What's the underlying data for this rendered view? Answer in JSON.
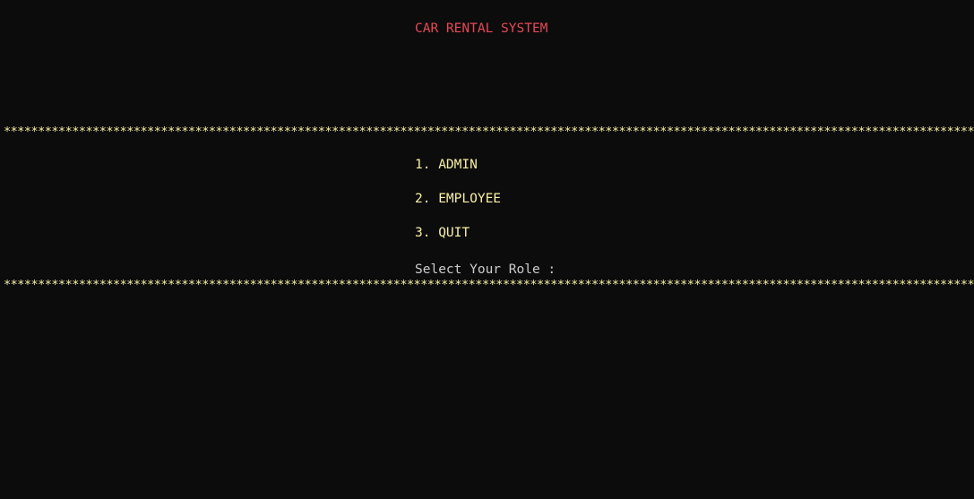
{
  "console": {
    "title": "CAR RENTAL SYSTEM",
    "separator": "*****************************************************************************************************************************************************************",
    "menu": [
      {
        "label": "1. ADMIN"
      },
      {
        "label": "2. EMPLOYEE"
      },
      {
        "label": "3. QUIT"
      }
    ],
    "prompt": "Select Your Role :"
  },
  "colors": {
    "background": "#0c0c0c",
    "title": "#e74856",
    "menu": "#f9f1a5",
    "separator": "#f9f1a5",
    "prompt": "#cccccc"
  }
}
